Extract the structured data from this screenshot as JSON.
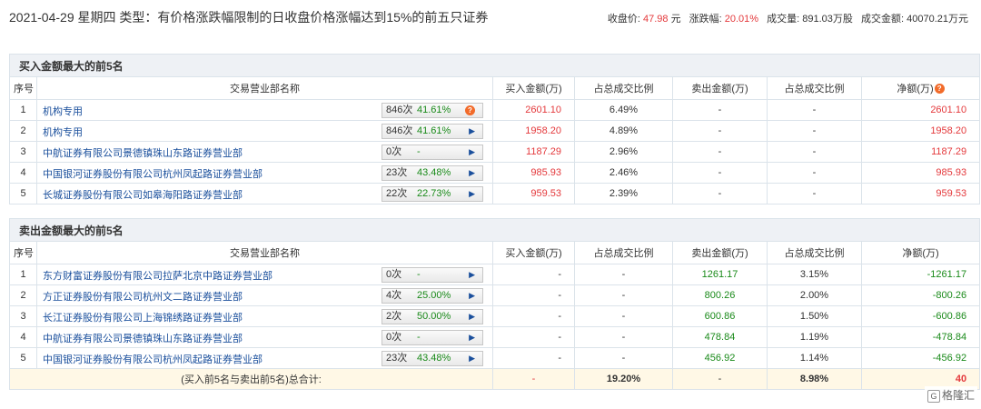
{
  "header": {
    "title": "2021-04-29 星期四 类型：有价格涨跌幅限制的日收盘价格涨幅达到15%的前五只证券",
    "close_label": "收盘价:",
    "close_value": "47.98",
    "close_unit": "元",
    "change_label": "涨跌幅:",
    "change_value": "20.01%",
    "volume_label": "成交量:",
    "volume_value": "891.03万股",
    "amount_label": "成交金额:",
    "amount_value": "40070.21万元"
  },
  "columns": {
    "idx": "序号",
    "broker": "交易营业部名称",
    "buy_amount": "买入金额(万)",
    "buy_ratio": "占总成交比例",
    "sell_amount": "卖出金额(万)",
    "sell_ratio": "占总成交比例",
    "net": "净额(万)",
    "net_sell": "净额(万)"
  },
  "buy_section": {
    "title": "买入金额最大的前5名",
    "rows": [
      {
        "idx": "1",
        "broker": "机构专用",
        "count": "846次",
        "pct": "41.61%",
        "buy": "2601.10",
        "buy_ratio": "6.49%",
        "sell": "-",
        "sell_ratio": "-",
        "net": "2601.10"
      },
      {
        "idx": "2",
        "broker": "机构专用",
        "count": "846次",
        "pct": "41.61%",
        "buy": "1958.20",
        "buy_ratio": "4.89%",
        "sell": "-",
        "sell_ratio": "-",
        "net": "1958.20"
      },
      {
        "idx": "3",
        "broker": "中航证券有限公司景德镇珠山东路证券营业部",
        "count": "0次",
        "pct": "-",
        "buy": "1187.29",
        "buy_ratio": "2.96%",
        "sell": "-",
        "sell_ratio": "-",
        "net": "1187.29"
      },
      {
        "idx": "4",
        "broker": "中国银河证券股份有限公司杭州凤起路证券营业部",
        "count": "23次",
        "pct": "43.48%",
        "buy": "985.93",
        "buy_ratio": "2.46%",
        "sell": "-",
        "sell_ratio": "-",
        "net": "985.93"
      },
      {
        "idx": "5",
        "broker": "长城证券股份有限公司如皋海阳路证券营业部",
        "count": "22次",
        "pct": "22.73%",
        "buy": "959.53",
        "buy_ratio": "2.39%",
        "sell": "-",
        "sell_ratio": "-",
        "net": "959.53"
      }
    ]
  },
  "sell_section": {
    "title": "卖出金额最大的前5名",
    "rows": [
      {
        "idx": "1",
        "broker": "东方财富证券股份有限公司拉萨北京中路证券营业部",
        "count": "0次",
        "pct": "-",
        "buy": "-",
        "buy_ratio": "-",
        "sell": "1261.17",
        "sell_ratio": "3.15%",
        "net": "-1261.17"
      },
      {
        "idx": "2",
        "broker": "方正证券股份有限公司杭州文二路证券营业部",
        "count": "4次",
        "pct": "25.00%",
        "buy": "-",
        "buy_ratio": "-",
        "sell": "800.26",
        "sell_ratio": "2.00%",
        "net": "-800.26"
      },
      {
        "idx": "3",
        "broker": "长江证券股份有限公司上海锦绣路证券营业部",
        "count": "2次",
        "pct": "50.00%",
        "buy": "-",
        "buy_ratio": "-",
        "sell": "600.86",
        "sell_ratio": "1.50%",
        "net": "-600.86"
      },
      {
        "idx": "4",
        "broker": "中航证券有限公司景德镇珠山东路证券营业部",
        "count": "0次",
        "pct": "-",
        "buy": "-",
        "buy_ratio": "-",
        "sell": "478.84",
        "sell_ratio": "1.19%",
        "net": "-478.84"
      },
      {
        "idx": "5",
        "broker": "中国银河证券股份有限公司杭州凤起路证券营业部",
        "count": "23次",
        "pct": "43.48%",
        "buy": "-",
        "buy_ratio": "-",
        "sell": "456.92",
        "sell_ratio": "1.14%",
        "net": "-456.92"
      }
    ]
  },
  "total": {
    "label": "(买入前5名与卖出前5名)总合计:",
    "buy": "-",
    "buy_ratio": "19.20%",
    "sell": "-",
    "sell_ratio": "8.98%",
    "net": "40"
  },
  "brand": "格隆汇",
  "colors": {
    "up": "#e4393c",
    "down": "#1a8a1a",
    "link": "#1a4f9c"
  }
}
